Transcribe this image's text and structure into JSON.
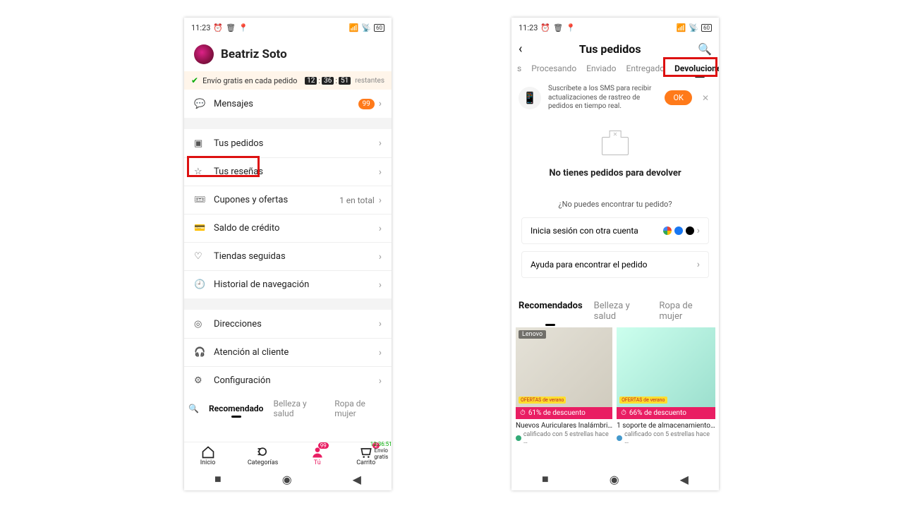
{
  "status": {
    "time": "11:23",
    "battery": "60"
  },
  "phone1": {
    "profile_name": "Beatriz Soto",
    "shipping_text": "Envío gratis en cada pedido",
    "countdown": [
      "12",
      "36",
      "51"
    ],
    "countdown_suffix": "restantes",
    "menu": {
      "mensajes": "Mensajes",
      "mensajes_badge": "99",
      "pedidos": "Tus pedidos",
      "resenas": "Tus reseñas",
      "cupones": "Cupones y ofertas",
      "cupones_count": "1 en total",
      "saldo": "Saldo de crédito",
      "tiendas": "Tiendas seguidas",
      "historial": "Historial de navegación",
      "direcciones": "Direcciones",
      "atencion": "Atención al cliente",
      "config": "Configuración"
    },
    "tabs": {
      "recomendado": "Recomendado",
      "belleza": "Belleza y salud",
      "ropa": "Ropa de mujer"
    },
    "bottom": {
      "inicio": "Inicio",
      "categorias": "Categorías",
      "tu": "Tú",
      "carrito": "Carrito",
      "tu_badge": "99",
      "carrito_badge": "2",
      "envio_timer": "12:36:51",
      "envio_label": "Envío gratis"
    }
  },
  "phone2": {
    "title": "Tus pedidos",
    "tabs": {
      "s": "s",
      "procesando": "Procesando",
      "enviado": "Enviado",
      "entregado": "Entregado",
      "devoluciones": "Devoluciones"
    },
    "sms_text": "Suscríbete a los SMS para recibir actualizaciones de rastreo de pedidos en tiempo real.",
    "ok": "OK",
    "empty_title": "No tienes pedidos para devolver",
    "empty_sub": "¿No puedes encontrar tu pedido?",
    "login_other": "Inicia sesión con otra cuenta",
    "help_find": "Ayuda para encontrar el pedido",
    "rec_tabs": {
      "recomendados": "Recomendados",
      "belleza": "Belleza y salud",
      "ropa": "Ropa de mujer"
    },
    "products": {
      "p1": {
        "brand": "Lenovo",
        "ofertas": "OFERTAS de verano",
        "discount": "61% de descuento",
        "title": "Nuevos Auriculares Inalámbri…",
        "rating": "calificado con 5 estrellas hace …"
      },
      "p2": {
        "ofertas": "OFERTAS de verano",
        "discount": "66% de descuento",
        "title": "1 soporte de almacenamiento…",
        "rating": "calificado con 5 estrellas hace …"
      }
    }
  }
}
